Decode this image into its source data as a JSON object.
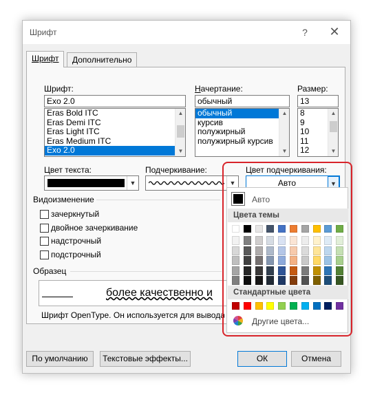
{
  "dialog": {
    "title": "Шрифт",
    "help_label": "?",
    "close_label": "✕",
    "tabs": [
      {
        "label": "Шрифт",
        "active": true
      },
      {
        "label": "Дополнительно",
        "active": false
      }
    ]
  },
  "font": {
    "label": "Шрифт:",
    "value": "Exo 2.0",
    "list": [
      "Eras Bold ITC",
      "Eras Demi ITC",
      "Eras Light ITC",
      "Eras Medium ITC",
      "Exo 2.0"
    ],
    "selected_index": 4
  },
  "style": {
    "label": "Начертание:",
    "value": "обычный",
    "list": [
      "обычный",
      "курсив",
      "полужирный",
      "полужирный курсив"
    ],
    "selected_index": 0
  },
  "size": {
    "label": "Размер:",
    "value": "13",
    "list": [
      "8",
      "9",
      "10",
      "11",
      "12"
    ]
  },
  "text_color": {
    "label": "Цвет текста:",
    "value_color": "#000000"
  },
  "underline": {
    "label": "Подчеркивание:"
  },
  "underline_color": {
    "label": "Цвет подчеркивания:",
    "value": "Авто"
  },
  "effects": {
    "title": "Видоизменение",
    "items": [
      "зачеркнутый",
      "двойное зачеркивание",
      "надстрочный",
      "подстрочный"
    ]
  },
  "preview": {
    "title": "Образец",
    "sample_text": "более качественно и",
    "caption": "Шрифт OpenType. Он используется для вывода ка"
  },
  "buttons": {
    "default": "По умолчанию",
    "text_effects": "Текстовые эффекты...",
    "ok": "ОК",
    "cancel": "Отмена"
  },
  "palette": {
    "auto_label": "Авто",
    "auto_color": "#000000",
    "theme_title": "Цвета темы",
    "theme_colors": [
      [
        "#ffffff",
        "#000000",
        "#e7e6e6",
        "#44546a",
        "#4472c4",
        "#ed7d31",
        "#a5a5a5",
        "#ffc000",
        "#5b9bd5",
        "#70ad47"
      ],
      [
        "#f2f2f2",
        "#808080",
        "#d0cece",
        "#d6dce4",
        "#d9e2f3",
        "#fbe5d5",
        "#ededed",
        "#fff2cc",
        "#deebf6",
        "#e2efd9"
      ],
      [
        "#d8d8d8",
        "#595959",
        "#aeabab",
        "#adb9ca",
        "#b4c6e7",
        "#f7caac",
        "#dbdbdb",
        "#fee599",
        "#bdd7ee",
        "#c5e0b3"
      ],
      [
        "#bfbfbf",
        "#404040",
        "#757070",
        "#8496b0",
        "#8eaadb",
        "#f4b183",
        "#c9c9c9",
        "#ffd965",
        "#9cc3e5",
        "#a8d08d"
      ],
      [
        "#a5a5a5",
        "#262626",
        "#3a3838",
        "#323f4f",
        "#2f5496",
        "#c55a11",
        "#7b7b7b",
        "#bf8f00",
        "#2e75b5",
        "#538135"
      ],
      [
        "#7f7f7f",
        "#0d0d0d",
        "#171616",
        "#222a35",
        "#1f3864",
        "#833c0b",
        "#525252",
        "#7f6000",
        "#1e4e79",
        "#375623"
      ]
    ],
    "standard_title": "Стандартные цвета",
    "standard_colors": [
      "#c00000",
      "#ff0000",
      "#ffc000",
      "#ffff00",
      "#92d050",
      "#00b050",
      "#00b0f0",
      "#0070c0",
      "#002060",
      "#7030a0"
    ],
    "more_label": "Другие цвета..."
  }
}
